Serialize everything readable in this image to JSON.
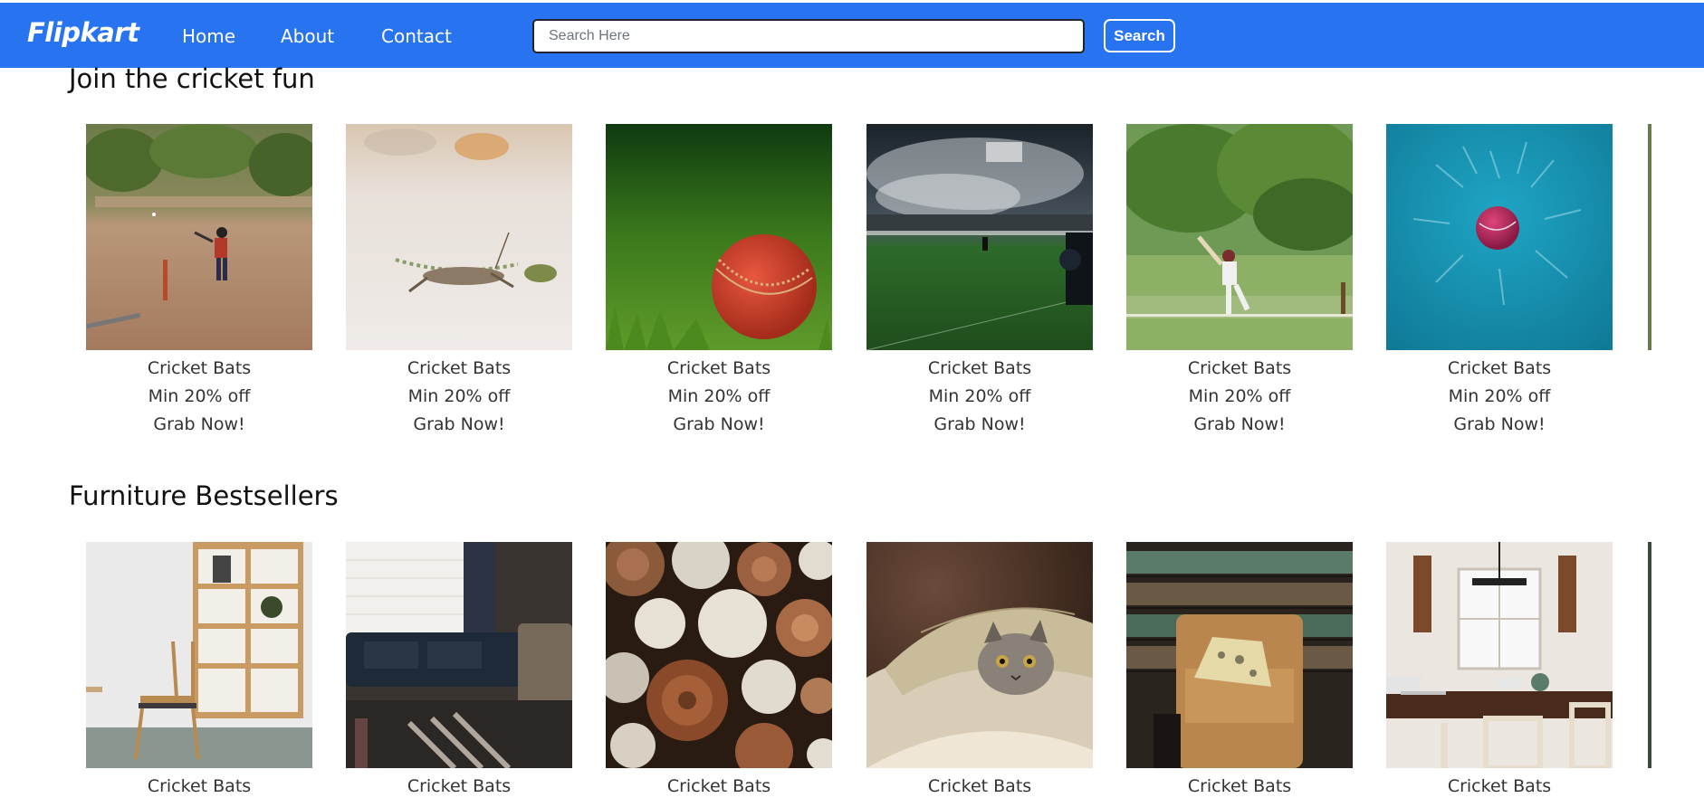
{
  "navbar": {
    "brand": "Flipkart",
    "links": [
      "Home",
      "About",
      "Contact"
    ],
    "search_placeholder": "Search Here",
    "search_button": "Search",
    "bg_color": "#2874f0"
  },
  "sections": [
    {
      "title": "Join the cricket fun",
      "cards": [
        {
          "line1": "Cricket Bats",
          "line2": "Min 20% off",
          "line3": "Grab Now!",
          "image": "street-cricket-photo"
        },
        {
          "line1": "Cricket Bats",
          "line2": "Min 20% off",
          "line3": "Grab Now!",
          "image": "grasshopper-on-sand-photo"
        },
        {
          "line1": "Cricket Bats",
          "line2": "Min 20% off",
          "line3": "Grab Now!",
          "image": "cricket-ball-on-grass-photo"
        },
        {
          "line1": "Cricket Bats",
          "line2": "Min 20% off",
          "line3": "Grab Now!",
          "image": "stadium-sprinkler-photo"
        },
        {
          "line1": "Cricket Bats",
          "line2": "Min 20% off",
          "line3": "Grab Now!",
          "image": "batsman-playing-shot-photo"
        },
        {
          "line1": "Cricket Bats",
          "line2": "Min 20% off",
          "line3": "Grab Now!",
          "image": "pink-ball-splash-photo"
        }
      ]
    },
    {
      "title": "Furniture Bestsellers",
      "cards": [
        {
          "line1": "Cricket Bats",
          "image": "chair-and-shelf-photo"
        },
        {
          "line1": "Cricket Bats",
          "image": "sofa-by-window-photo"
        },
        {
          "line1": "Cricket Bats",
          "image": "stacked-logs-photo"
        },
        {
          "line1": "Cricket Bats",
          "image": "cat-under-pillow-photo"
        },
        {
          "line1": "Cricket Bats",
          "image": "armchair-in-library-photo"
        },
        {
          "line1": "Cricket Bats",
          "image": "dining-table-laptop-photo"
        }
      ]
    }
  ]
}
